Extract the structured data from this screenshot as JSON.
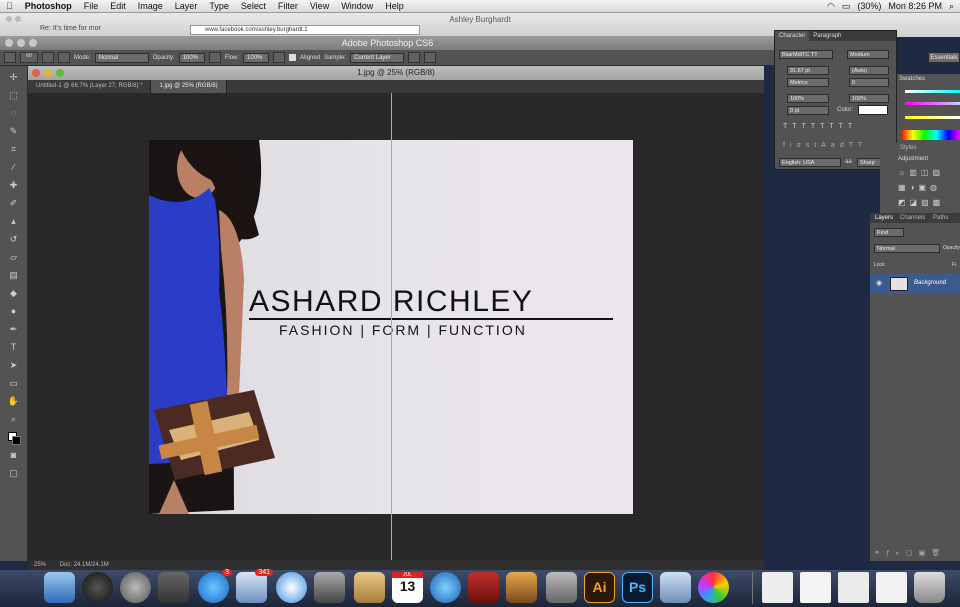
{
  "menubar": {
    "app": "Photoshop",
    "items": [
      "File",
      "Edit",
      "Image",
      "Layer",
      "Type",
      "Select",
      "Filter",
      "View",
      "Window",
      "Help"
    ],
    "battery": "(30%)",
    "clock": "Mon 8:26 PM"
  },
  "browser": {
    "title": "Ashley Burghardt",
    "tab1": "Re: It's time for mor",
    "url": "www.facebook.com/ashley.burghardt.1"
  },
  "ps": {
    "title": "Adobe Photoshop CS6",
    "workspace": "Essentials"
  },
  "options": {
    "mode_label": "Mode:",
    "mode": "Normal",
    "opacity_label": "Opacity:",
    "opacity": "100%",
    "flow_label": "Flow:",
    "flow": "100%",
    "aligned": "Aligned",
    "sample_label": "Sample:",
    "sample": "Current Layer",
    "brush_size": "60"
  },
  "document": {
    "title": "1.jpg @ 25% (RGB/8)",
    "tabs": [
      "Untitled-1 @ 66.7% (Layer 27, RGB/8) *",
      "1.jpg @ 25% (RGB/8)"
    ],
    "zoom": "25%",
    "doc_info": "Doc: 24.1M/24.1M"
  },
  "artwork": {
    "title": "ASHARD RICHLEY",
    "subtitle": "FASHION | FORM | FUNCTION"
  },
  "character": {
    "tab1": "Character",
    "tab2": "Paragraph",
    "font": "BlairMdITC TT",
    "style": "Medium",
    "size": "91.67 pt",
    "leading": "(Auto)",
    "kerning": "Metrics",
    "tracking": "0",
    "vscale": "100%",
    "hscale": "100%",
    "baseline": "0 pt",
    "color_label": "Color:",
    "language": "English: USA",
    "aa": "Sharp",
    "aa_label": "aa"
  },
  "panels": {
    "swatches": "Swatches",
    "styles": "Styles",
    "adjustments": "Adjustment",
    "layers": "Layers",
    "channels": "Channels",
    "paths": "Paths",
    "kind": "Kind",
    "blend": "Normal",
    "opacity": "Opacity",
    "lock": "Lock:",
    "fill": "Fi",
    "layer_name": "Background"
  },
  "dock": {
    "badge_appstore": "3",
    "badge_mail": "341",
    "calendar_day": "13",
    "calendar_month": "JUL",
    "ai": "Ai",
    "ps": "Ps"
  },
  "colors": {
    "menubar": "#e6e6e6",
    "ps_ui": "#535353",
    "canvas_bg": "#282828",
    "guide": "#5dc7d6"
  }
}
